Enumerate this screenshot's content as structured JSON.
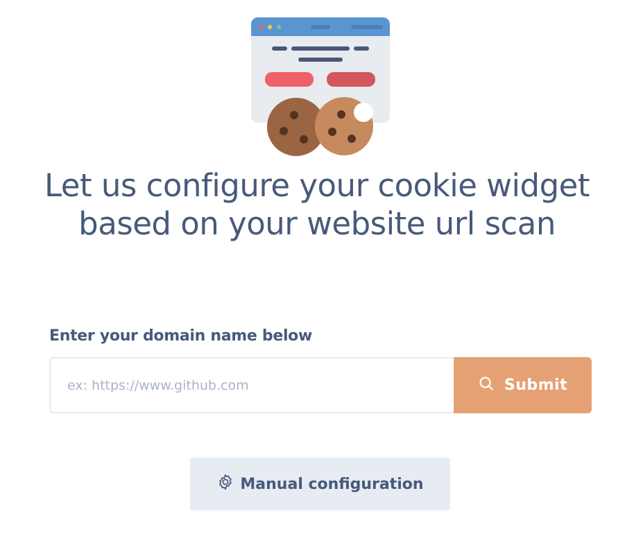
{
  "illustration": {
    "name": "browser-with-cookies-illustration"
  },
  "headline": "Let us configure your cookie widget based on your website url scan",
  "form": {
    "label": "Enter your domain name below",
    "input_value": "",
    "input_placeholder": "ex: https://www.github.com",
    "submit_label": "Submit",
    "submit_icon": "search-icon"
  },
  "manual": {
    "label": "Manual configuration",
    "icon": "gear-icon"
  },
  "colors": {
    "text": "#475a7a",
    "accent": "#e5a174",
    "secondary_button": "#e7ebf2",
    "input_border": "#e7e9ee",
    "placeholder": "#a9b4c8"
  }
}
